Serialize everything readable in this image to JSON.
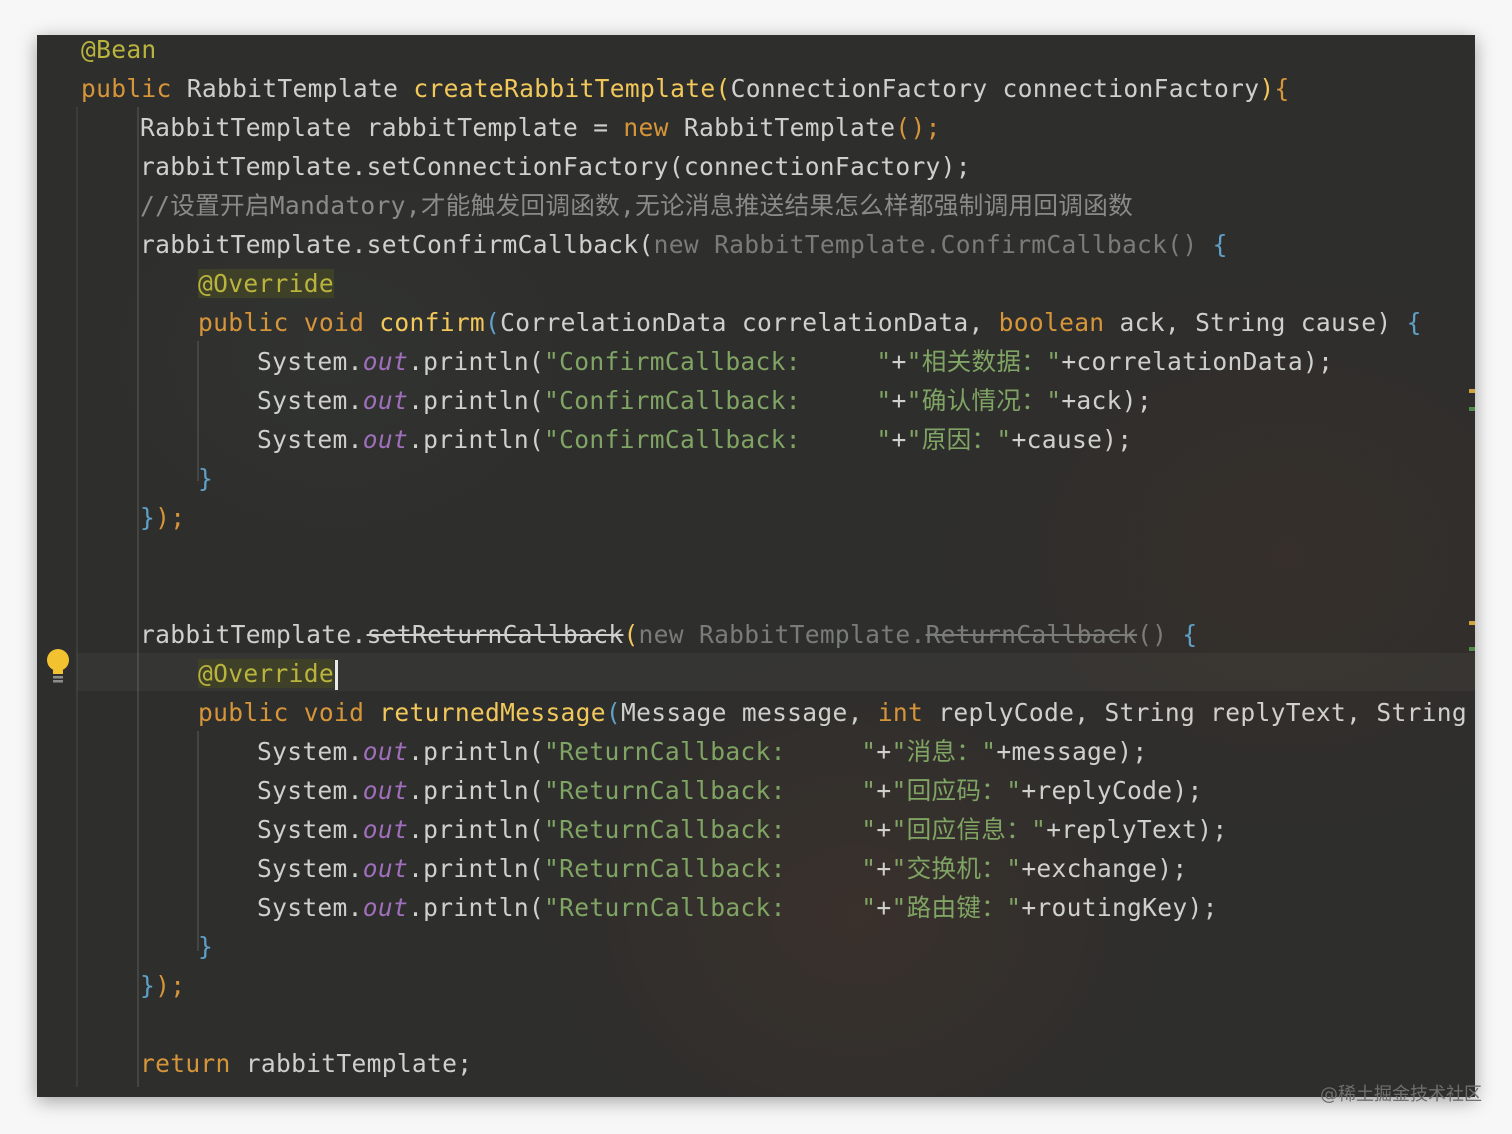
{
  "editor": {
    "lines": {
      "l01": {
        "a": "@Bean"
      },
      "l02": {
        "kw": "public ",
        "type": "RabbitTemplate ",
        "fn": "createRabbitTemplate",
        "p1": "(",
        "params": "ConnectionFactory connectionFactory",
        "p2": ")",
        "brace": "{"
      },
      "l03": {
        "a": "RabbitTemplate rabbitTemplate = ",
        "kw": "new ",
        "b": "RabbitTemplate",
        "c": "();"
      },
      "l04": {
        "a": "rabbitTemplate.setConnectionFactory(connectionFactory);"
      },
      "l05": {
        "comment": "//设置开启Mandatory,才能触发回调函数,无论消息推送结果怎么样都强制调用回调函数"
      },
      "l06": {
        "a": "rabbitTemplate.setConfirmCallback(",
        "dim": "new RabbitTemplate.ConfirmCallback() ",
        "brace": "{"
      },
      "l07": {
        "ann": "@Override"
      },
      "l08": {
        "kw1": "public void ",
        "fn": "confirm",
        "p1": "(",
        "a": "CorrelationData correlationData, ",
        "kw2": "boolean ",
        "b": "ack, String cause) ",
        "brace": "{"
      },
      "l09": {
        "a": "System.",
        "out": "out",
        "b": ".println(",
        "s1": "\"ConfirmCallback:     \"",
        "c": "+",
        "s2": "\"相关数据：\"",
        "d": "+correlationData);"
      },
      "l10": {
        "a": "System.",
        "out": "out",
        "b": ".println(",
        "s1": "\"ConfirmCallback:     \"",
        "c": "+",
        "s2": "\"确认情况：\"",
        "d": "+ack);"
      },
      "l11": {
        "a": "System.",
        "out": "out",
        "b": ".println(",
        "s1": "\"ConfirmCallback:     \"",
        "c": "+",
        "s2": "\"原因：\"",
        "d": "+cause);"
      },
      "l12": {
        "brace": "}"
      },
      "l13": {
        "brace": "}",
        "a": ");"
      },
      "l14": {
        "a": "rabbitTemplate.",
        "strike": "setReturnCallback",
        "b": "(",
        "dim1": "new RabbitTemplate.",
        "dimstrike": "ReturnCallback",
        "dim2": "() ",
        "brace": "{"
      },
      "l15": {
        "ann": "@Override"
      },
      "l16": {
        "kw1": "public void ",
        "fn": "returnedMessage",
        "p1": "(",
        "a": "Message message, ",
        "kw2": "int ",
        "b": "replyCode, String replyText, String ex"
      },
      "l17": {
        "a": "System.",
        "out": "out",
        "b": ".println(",
        "s1": "\"ReturnCallback:     \"",
        "c": "+",
        "s2": "\"消息：\"",
        "d": "+message);"
      },
      "l18": {
        "a": "System.",
        "out": "out",
        "b": ".println(",
        "s1": "\"ReturnCallback:     \"",
        "c": "+",
        "s2": "\"回应码：\"",
        "d": "+replyCode);"
      },
      "l19": {
        "a": "System.",
        "out": "out",
        "b": ".println(",
        "s1": "\"ReturnCallback:     \"",
        "c": "+",
        "s2": "\"回应信息：\"",
        "d": "+replyText);"
      },
      "l20": {
        "a": "System.",
        "out": "out",
        "b": ".println(",
        "s1": "\"ReturnCallback:     \"",
        "c": "+",
        "s2": "\"交换机：\"",
        "d": "+exchange);"
      },
      "l21": {
        "a": "System.",
        "out": "out",
        "b": ".println(",
        "s1": "\"ReturnCallback:     \"",
        "c": "+",
        "s2": "\"路由键：\"",
        "d": "+routingKey);"
      },
      "l22": {
        "brace": "}"
      },
      "l23": {
        "brace": "}",
        "a": ");"
      },
      "l24": {
        "kw": "return ",
        "a": "rabbitTemplate;"
      }
    }
  },
  "watermark": "@稀土掘金技术社区",
  "colors": {
    "background": "#2e2e2c",
    "keyword": "#d7953a",
    "method": "#f2c85b",
    "annotation": "#b9b43d",
    "string": "#7fa463",
    "comment": "#8a8b86",
    "field": "#a06fbc",
    "brace": "#5fa0c8"
  },
  "icons": {
    "gutter": "lightbulb-icon"
  }
}
